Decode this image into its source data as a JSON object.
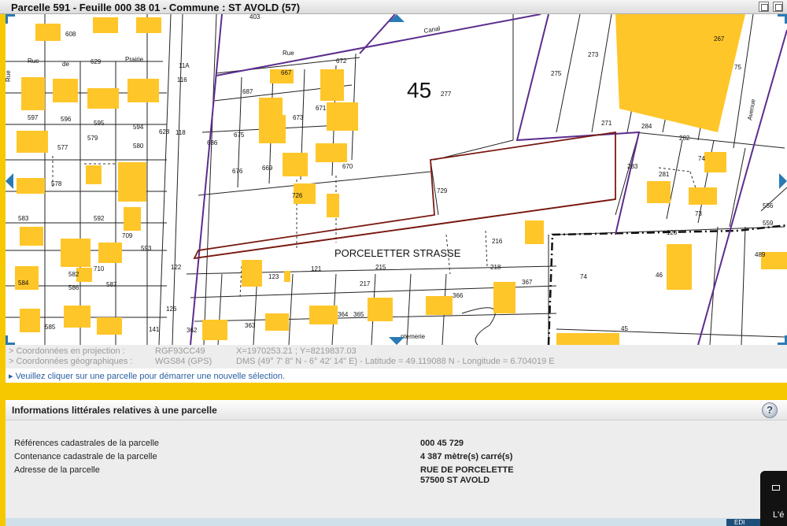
{
  "window": {
    "title": "Parcelle 591 - Feuille 000 38 01 - Commune : ST AVOLD (57)"
  },
  "map": {
    "section_label": "45",
    "street_name": "PORCELETTER STRASSE",
    "selected_parcel": "729",
    "parcel_numbers": [
      "608",
      "629",
      "597",
      "596",
      "595",
      "594",
      "628",
      "577",
      "579",
      "580",
      "578",
      "583",
      "592",
      "709",
      "593",
      "584",
      "582",
      "710",
      "587",
      "586",
      "585",
      "11A",
      "116",
      "118",
      "686",
      "687",
      "667",
      "673",
      "671",
      "675",
      "676",
      "669",
      "670",
      "672",
      "277",
      "273",
      "275",
      "271",
      "267",
      "75",
      "284",
      "282",
      "74",
      "283",
      "281",
      "73",
      "726",
      "729",
      "556",
      "559",
      "489",
      "126",
      "46",
      "74",
      "216",
      "367",
      "366",
      "364",
      "365",
      "215",
      "121",
      "123",
      "122",
      "217",
      "126",
      "362",
      "363",
      "45",
      "141",
      "403"
    ],
    "street_labels": [
      "Rue",
      "de",
      "Prairie",
      "Rue",
      "Canal",
      "Avenue",
      "ntemerie",
      "Rue"
    ]
  },
  "coords": {
    "proj_label": "> Coordonnées en projection :",
    "proj_system": "RGF93CC49",
    "proj_value": "X=1970253.21 ; Y=8219837.03",
    "geo_label": "> Coordonnées géographiques :",
    "geo_system": "WGS84 (GPS)",
    "geo_value": "DMS (49° 7' 8\" N - 6° 42' 14\" E) - Latitude = 49.119088 N - Longitude = 6.704019 E"
  },
  "hint": "▸ Veuillez cliquer sur une parcelle pour démarrer une nouvelle sélection.",
  "info": {
    "title": "Informations littérales relatives à une parcelle",
    "help_glyph": "?",
    "rows": [
      {
        "label": "Références cadastrales de la parcelle",
        "value": "000 45 729"
      },
      {
        "label": "Contenance cadastrale de la parcelle",
        "value": "4 387 mètre(s) carré(s)"
      },
      {
        "label": "Adresse de la parcelle",
        "value": "RUE DE PORCELETTE",
        "value2": "57500 ST AVOLD"
      }
    ],
    "edit_button": "EDI"
  },
  "side_widget": {
    "text": "L'é"
  },
  "colors": {
    "accent_yellow": "#f6c800",
    "building": "#ffc629",
    "commune_boundary": "#5b2d8e",
    "selected_parcel": "#7a1a12",
    "nav_blue": "#2a7ab5",
    "link_blue": "#2a5fa0"
  }
}
